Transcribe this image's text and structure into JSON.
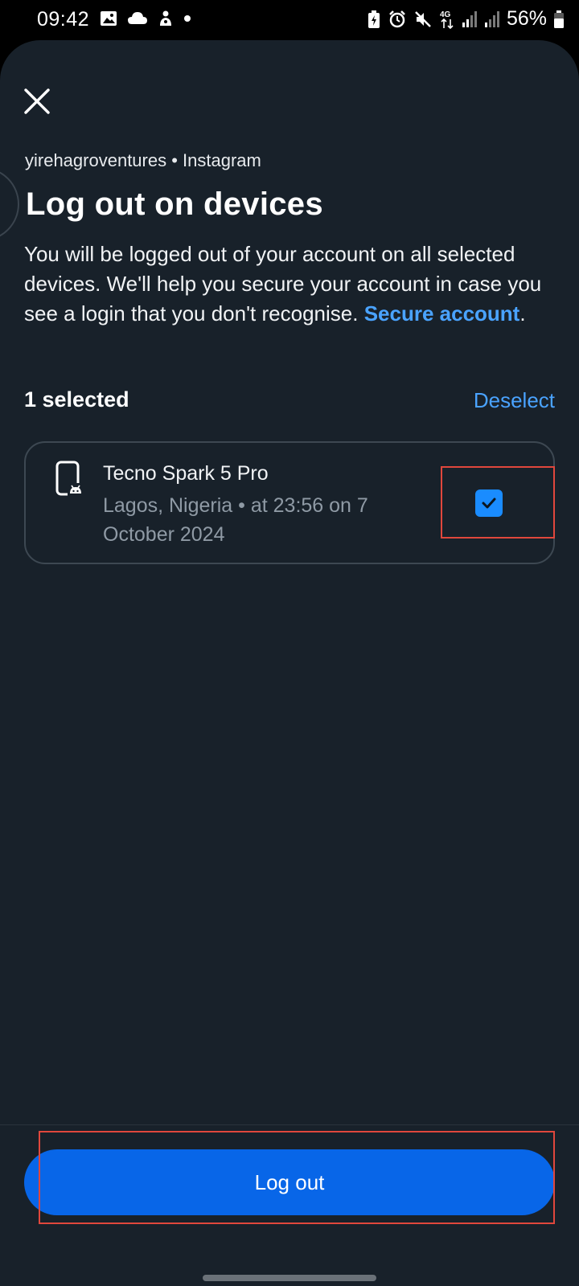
{
  "status_bar": {
    "time": "09:42",
    "battery_percent": "56%",
    "icons_left": [
      "image-icon",
      "cloud-icon",
      "notification-icon",
      "dot-icon"
    ],
    "icons_right": [
      "battery-saver-icon",
      "alarm-icon",
      "mute-icon",
      "network-4g-icon",
      "signal-icon",
      "signal-icon",
      "battery-icon"
    ],
    "network_label": "4G"
  },
  "header": {
    "close_icon": "close-icon",
    "subtitle": "yirehagroventures • Instagram",
    "title": "Log out on devices"
  },
  "description": {
    "text": "You will be logged out of your account on all selected devices. We'll help you secure your account in case you see a login that you don't recognise. ",
    "link": "Secure account",
    "trailing": "."
  },
  "selection": {
    "count_label": "1 selected",
    "deselect_label": "Deselect"
  },
  "devices": [
    {
      "icon": "android-phone-icon",
      "name": "Tecno Spark 5 Pro",
      "meta": "Lagos, Nigeria • at 23:56 on 7 October 2024",
      "checked": true
    }
  ],
  "actions": {
    "logout_label": "Log out"
  },
  "colors": {
    "sheet_bg": "#18212a",
    "accent_link": "#4aa3ff",
    "checkbox": "#1a8cff",
    "primary_button": "#0866e8",
    "annotation": "#e0473c"
  }
}
